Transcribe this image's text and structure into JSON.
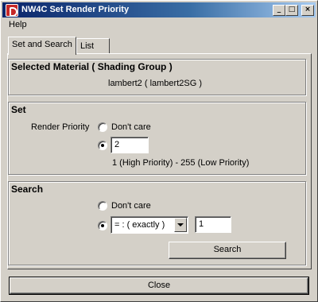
{
  "window": {
    "title": "NW4C Set Render Priority",
    "controls": {
      "minimize": "_",
      "maximize": "□",
      "close": "×"
    }
  },
  "menu": {
    "help": "Help"
  },
  "tabs": [
    {
      "label": "Set and Search",
      "active": true
    },
    {
      "label": "List",
      "active": false
    }
  ],
  "selected_material": {
    "title": "Selected Material ( Shading Group )",
    "value": "lambert2 ( lambert2SG )"
  },
  "set": {
    "title": "Set",
    "render_priority_label": "Render Priority",
    "dont_care_label": "Don't care",
    "dont_care_selected": false,
    "value_selected": true,
    "value": "2",
    "range_hint": "1 (High Priority) - 255 (Low Priority)"
  },
  "search": {
    "title": "Search",
    "dont_care_label": "Don't care",
    "dont_care_selected": false,
    "condition_selected": true,
    "condition": "= : ( exactly )",
    "value": "1",
    "button_label": "Search"
  },
  "footer": {
    "close_label": "Close"
  }
}
